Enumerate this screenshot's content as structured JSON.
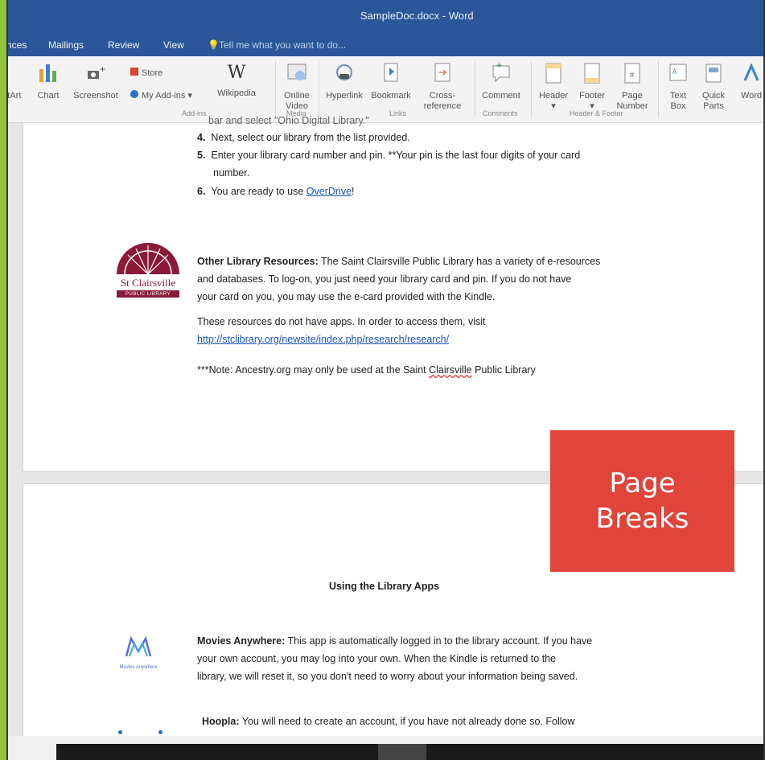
{
  "window": {
    "title": "SampleDoc.docx - Word"
  },
  "menu": {
    "items": [
      "nces",
      "Mailings",
      "Review",
      "View"
    ],
    "tell_me": "Tell me what you want to do..."
  },
  "ribbon": {
    "insert_left": [
      "rtArt",
      "Chart",
      "Screenshot"
    ],
    "addins": {
      "store": "Store",
      "my_addins": "My Add-ins",
      "wikipedia": "Wikipedia",
      "group": "Add-ins"
    },
    "media": {
      "online_video": "Online Video",
      "group": "Media"
    },
    "links": {
      "hyperlink": "Hyperlink",
      "bookmark": "Bookmark",
      "cross_reference": "Cross-reference",
      "group": "Links"
    },
    "comments": {
      "comment": "Comment",
      "group": "Comments"
    },
    "header_footer": {
      "header": "Header",
      "footer": "Footer",
      "page_number": "Page Number",
      "group": "Header & Footer"
    },
    "text": {
      "text_box": "Text Box",
      "quick_parts": "Quick Parts",
      "wordart": "Word"
    },
    "icons": [
      "chart-icon",
      "screenshot-icon",
      "store-icon",
      "wikipedia-icon",
      "video-icon",
      "hyperlink-icon",
      "bookmark-icon",
      "cross-reference-icon",
      "comment-icon",
      "header-icon",
      "footer-icon",
      "page-number-icon",
      "text-box-icon",
      "quick-parts-icon",
      "wordart-icon"
    ]
  },
  "page1": {
    "cut_line": "bar and select \"Ohio Digital Library.\"",
    "steps": [
      {
        "num": "4.",
        "text": "Next, select our library from the list provided."
      },
      {
        "num": "5.",
        "text": "Enter your library card number and pin. **Your pin is the last four digits of your card",
        "cont": "number."
      },
      {
        "num": "6.",
        "text_before": "You are ready to use ",
        "link": "OverDrive",
        "text_after": "!"
      }
    ],
    "logo": {
      "line1": "St Clairsville",
      "line2": "PUBLIC LIBRARY",
      "color": "#8b1a3a"
    },
    "other_resources": {
      "heading": "Other Library Resources:",
      "line1": " The Saint Clairsville Public Library has a variety of e-resources",
      "line2": "and databases. To log-on, you just need your library card and pin. If you do not have",
      "line3": "your card on you, you may use the e-card provided with the Kindle."
    },
    "no_apps_line": "These resources do not have apps. In order to access them, visit",
    "url": "http://stclibrary.org/newsite/index.php/research/research/",
    "note": {
      "before": "***Note: Ancestry.org may only be used at the Saint ",
      "flag": "Clairsville",
      "after": " Public Library"
    }
  },
  "callout": {
    "line1": "Page",
    "line2": "Breaks",
    "color": "#e0443a"
  },
  "page2": {
    "heading": "Using the Library Apps",
    "movies": {
      "heading": "Movies Anywhere:",
      "line1": " This app is automatically logged in to the library account. If you have",
      "line2": "your own account, you may log into your own. When the Kindle is returned to the",
      "line3": "library, we will reset it, so you don't need to worry about your information being saved.",
      "logo_caption": "Movies Anywhere"
    },
    "hoopla": {
      "heading": "Hoopla:",
      "line1": " You will need to create an account, if you have not already done so. Follow"
    }
  },
  "colors": {
    "title_bar": "#2b579a",
    "green_accent": "#8fc33a",
    "link": "#1a56b8"
  }
}
